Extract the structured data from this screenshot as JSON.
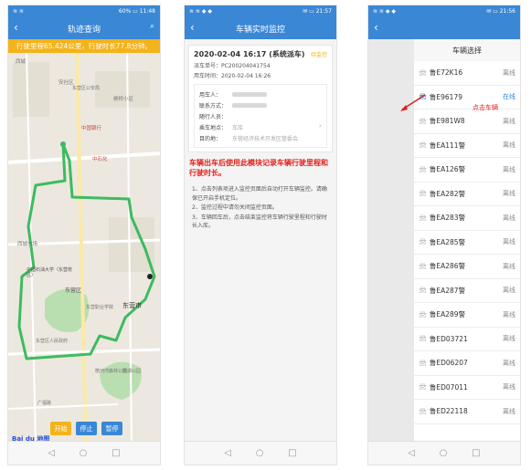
{
  "phone1": {
    "status_left": "≋ ≋",
    "status_right": "60% ▭ 11:48",
    "title": "轨迹查询",
    "banner": "行驶里程65.424公里，行驶时长77.8分钟。",
    "map_labels": [
      "西城",
      "安社区",
      "东营市",
      "中国银行",
      "柳桥小区",
      "中石化",
      "东营区",
      "东营市",
      "中国石油大学（东营校区）",
      "西城市场",
      "东营区公安局",
      "东营职业学院",
      "东营区人民政府",
      "丽河湾森林公园",
      "西湖公园",
      "黄河路",
      "广福路"
    ],
    "controls": {
      "start": "开始",
      "stop": "停止",
      "pause": "暂停"
    },
    "logo": "Bai du 地图"
  },
  "phone2": {
    "status_left": "≋ ≋ ◆ ◆",
    "status_right": "✉ ▭ 21:57",
    "title": "车辆实时监控",
    "datetime": "2020-02-04 16:17 (系统派车)",
    "tag": "待监控",
    "order_label": "派车单号：",
    "order_value": "PC200204041754",
    "time_label": "用车时间：",
    "time_value": "2020-02-04 16:26",
    "fields": [
      {
        "k": "用车人：",
        "v": ""
      },
      {
        "k": "联系方式：",
        "v": ""
      },
      {
        "k": "随行人员：",
        "v": ""
      },
      {
        "k": "乘车地点：",
        "v": "车库"
      },
      {
        "k": "目的地：",
        "v": "东营经济技术开发区管委会"
      }
    ],
    "warning": "车辆出车后使用此模块记录车辆行驶里程和行驶时长。",
    "tips": [
      "1、点击列表项进入监控页面后自动打开车辆监控。请确保已开启手机定位。",
      "2、监控过程中请勿关闭监控页面。",
      "3、车辆回车后，点击结束监控将车辆行驶里程和行驶时长入库。"
    ]
  },
  "phone3": {
    "status_left": "≋ ≋ ◆ ◆",
    "status_right": "✉ ▭ 21:56",
    "title": "车辆选择",
    "annotation": "点击车辆",
    "vehicles": [
      {
        "plate": "鲁E72K16",
        "status": "离线"
      },
      {
        "plate": "鲁E96179",
        "status": "在线"
      },
      {
        "plate": "鲁E981W8",
        "status": "离线"
      },
      {
        "plate": "鲁EA111警",
        "status": "离线"
      },
      {
        "plate": "鲁EA126警",
        "status": "离线"
      },
      {
        "plate": "鲁EA282警",
        "status": "离线"
      },
      {
        "plate": "鲁EA283警",
        "status": "离线"
      },
      {
        "plate": "鲁EA285警",
        "status": "离线"
      },
      {
        "plate": "鲁EA286警",
        "status": "离线"
      },
      {
        "plate": "鲁EA287警",
        "status": "离线"
      },
      {
        "plate": "鲁EA289警",
        "status": "离线"
      },
      {
        "plate": "鲁ED03721",
        "status": "离线"
      },
      {
        "plate": "鲁ED06207",
        "status": "离线"
      },
      {
        "plate": "鲁ED07011",
        "status": "离线"
      },
      {
        "plate": "鲁ED22118",
        "status": "离线"
      }
    ]
  },
  "colors": {
    "primary": "#3a87d6",
    "accent": "#f3b31b",
    "warning": "#e0201b",
    "route": "#3dbb5f"
  }
}
